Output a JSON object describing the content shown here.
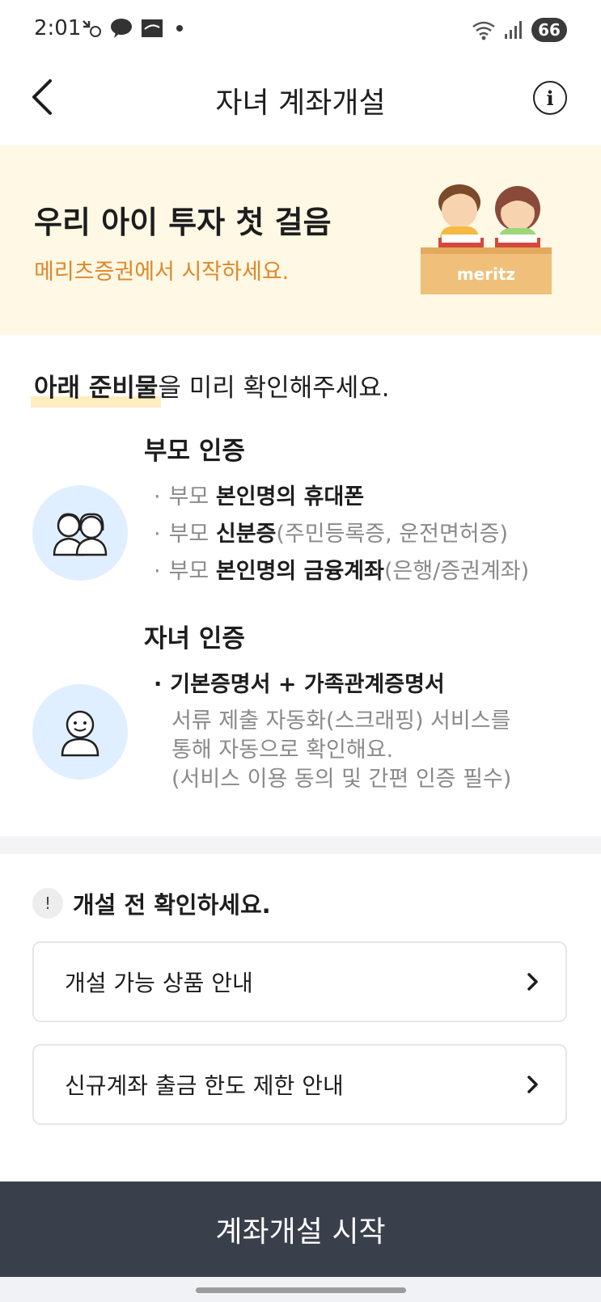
{
  "status_bar": {
    "time": "2:01",
    "battery": "66",
    "icons": [
      "missed-call-icon",
      "kakaotalk-icon",
      "mail-icon",
      "notification-dot",
      "wifi-icon",
      "signal-icon",
      "battery-icon"
    ]
  },
  "header": {
    "title": "자녀 계좌개설",
    "back_icon": "chevron-left-icon",
    "info_icon": "info-icon"
  },
  "banner": {
    "title": "우리 아이 투자 첫 걸음",
    "subtitle": "메리츠증권에서 시작하세요.",
    "illustration_text": "meritz",
    "subtitle_color": "#e0872a",
    "background_color": "#fef8e4"
  },
  "requirements": {
    "intro_highlight": "아래 준비물",
    "intro_rest": "을 미리 확인해주세요.",
    "parent": {
      "title": "부모 인증",
      "items": [
        {
          "prefix": "부모 ",
          "bold": "본인명의 휴대폰",
          "suffix": ""
        },
        {
          "prefix": "부모 ",
          "bold": "신분증",
          "suffix": "(주민등록증, 운전면허증)"
        },
        {
          "prefix": "부모 ",
          "bold": "본인명의 금융계좌",
          "suffix": "(은행/증권계좌)"
        }
      ]
    },
    "child": {
      "title": "자녀 인증",
      "bullet": "기본증명서 + 가족관계증명서",
      "desc_lines": [
        "서류 제출 자동화(스크래핑) 서비스를",
        "통해 자동으로 확인해요.",
        "(서비스 이용 동의 및 간편 인증 필수)"
      ]
    },
    "avatar_bg_color": "#e0efff"
  },
  "notice": {
    "title": "개설 전 확인하세요.",
    "cards": [
      {
        "label": "개설 가능 상품 안내"
      },
      {
        "label": "신규계좌 출금 한도 제한 안내"
      }
    ]
  },
  "cta": {
    "label": "계좌개설 시작",
    "color": "#3a3f4c"
  }
}
